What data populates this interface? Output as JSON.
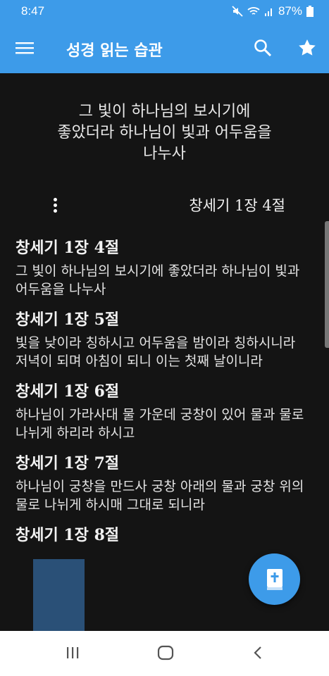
{
  "status_bar": {
    "time": "8:47",
    "battery": "87%"
  },
  "app_bar": {
    "title": "성경 읽는 습관"
  },
  "hero_lines": [
    "그 빛이 하나님의 보시기에",
    "좋았더라 하나님이 빛과 어두움을",
    "나누사"
  ],
  "current_reference": "창세기 1장 4절",
  "verses": [
    {
      "title": "창세기 1장 4절",
      "text": "그 빛이 하나님의 보시기에 좋았더라 하나님이 빛과 어두움을 나누사"
    },
    {
      "title": "창세기 1장 5절",
      "text": "빛을 낮이라 칭하시고 어두움을 밤이라 칭하시니라 저녁이 되며 아침이 되니 이는 첫째 날이니라"
    },
    {
      "title": "창세기 1장 6절",
      "text": "하나님이 가라사대 물 가운데 궁창이 있어 물과 물로 나뉘게 하리라 하시고"
    },
    {
      "title": "창세기 1장 7절",
      "text": "하나님이 궁창을 만드사 궁창 아래의 물과 궁창 위의 물로 나뉘게 하시매 그대로 되니라"
    },
    {
      "title": "창세기 1장 8절",
      "text": ""
    }
  ],
  "colors": {
    "accent": "#3d9be9",
    "background": "#141414"
  }
}
